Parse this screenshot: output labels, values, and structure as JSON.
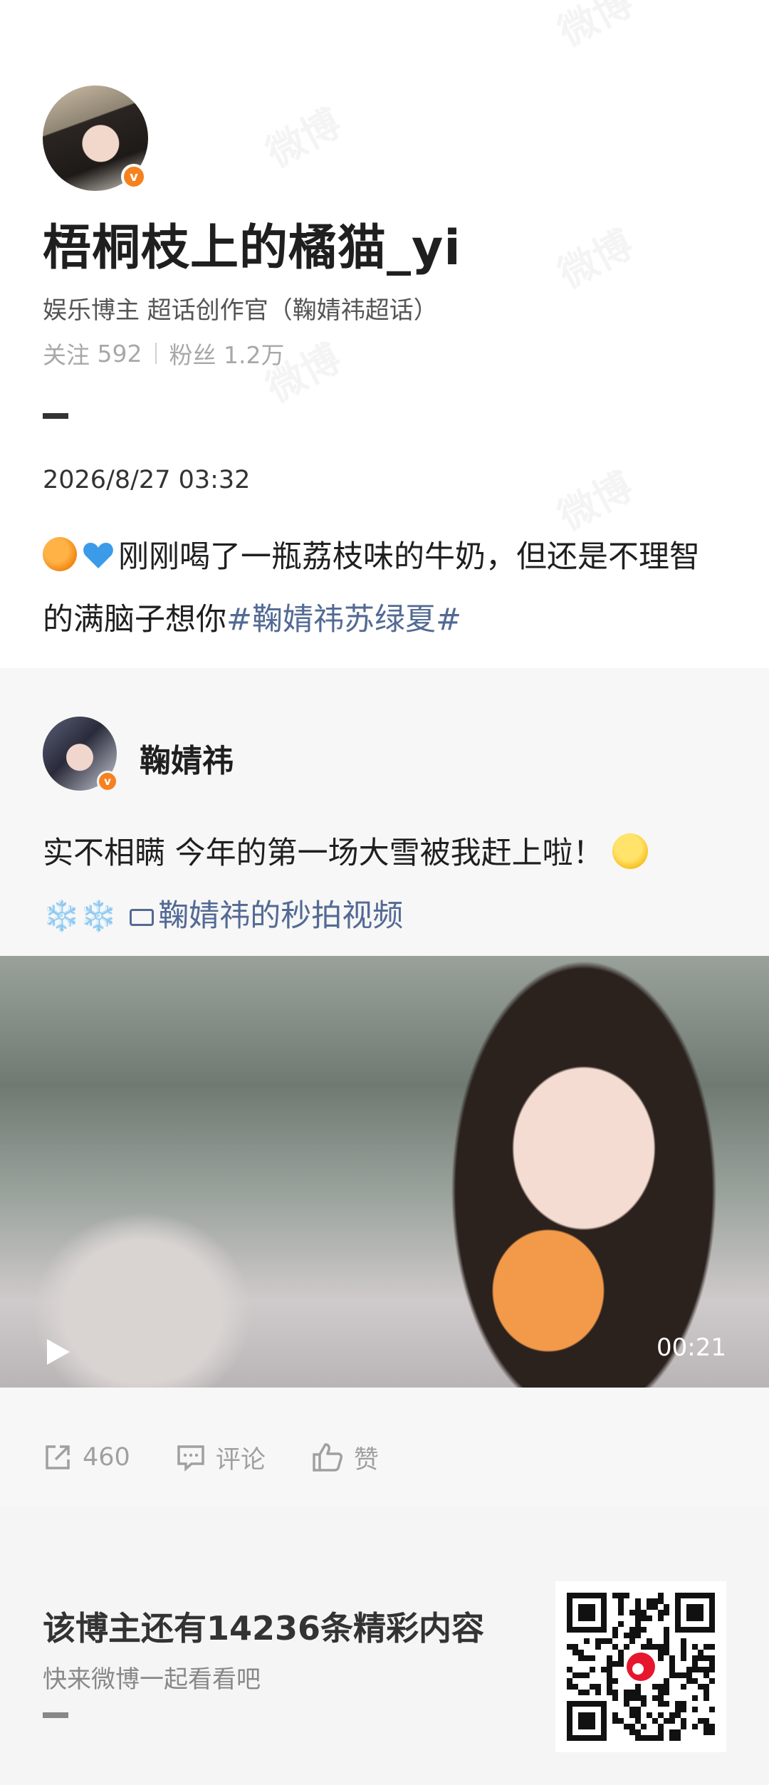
{
  "watermark": "微博",
  "profile": {
    "username": "梧桐枝上的橘猫_yi",
    "tagline": "娱乐博主 超话创作官（鞠婧祎超话）",
    "following_label": "关注",
    "following_count": "592",
    "followers_label": "粉丝",
    "followers_count": "1.2万",
    "verified_badge": "v"
  },
  "post": {
    "timestamp": "2026/8/27 03:32",
    "text_part1": "刚刚喝了一瓶荔枝味的牛奶，但还是不理智的满脑子想你",
    "topic": "#鞠婧祎苏绿夏#",
    "emojis": [
      "orange-emoji",
      "blue-heart-emoji"
    ]
  },
  "repost": {
    "author": "鞠婧祎",
    "text": "实不相瞒 今年的第一场大雪被我赶上啦！",
    "snowflakes": "❄️❄️",
    "video_link": "鞠婧祎的秒拍视频",
    "video_duration": "00:21"
  },
  "actions": {
    "repost_count": "460",
    "comment_label": "评论",
    "like_label": "赞"
  },
  "footer": {
    "title": "该博主还有14236条精彩内容",
    "subtitle": "快来微博一起看看吧"
  },
  "colors": {
    "topic_link": "#536a94",
    "verified_orange": "#f5821f",
    "muted_gray": "#a0a0a0"
  }
}
